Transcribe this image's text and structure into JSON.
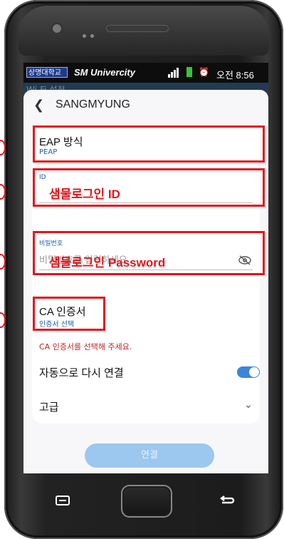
{
  "status_bar": {
    "logo_text": "상명대학교",
    "carrier": "SM Univercity",
    "time": "오전 8:56"
  },
  "previous_screen_title": "Wi-Fi 설정",
  "header": {
    "title": "SANGMYUNG"
  },
  "eap": {
    "label": "EAP 방식",
    "value": "PEAP"
  },
  "identity": {
    "label": "ID",
    "annotation": "샘물로그인 ID"
  },
  "password": {
    "label": "비밀번호",
    "placeholder": "비밀번호를 입력하세요",
    "annotation": "샘물로그인 Password"
  },
  "ca_cert": {
    "label": "CA 인증서",
    "value": "인증서 선택",
    "error": "CA 인증서를 선택해 주세요."
  },
  "auto_reconnect": {
    "label": "자동으로 다시 연결",
    "enabled": true
  },
  "advanced": {
    "label": "고급"
  },
  "connect_button": {
    "label": "연결"
  },
  "colors": {
    "accent_blue": "#3a86d8",
    "annotation_red": "#e5141a",
    "error_red": "#c0202a"
  },
  "icons": [
    "back-icon",
    "eye-slash-icon",
    "chevron-down-icon",
    "menu-icon",
    "home-button",
    "return-icon",
    "signal-icon",
    "battery-icon",
    "alarm-icon"
  ]
}
